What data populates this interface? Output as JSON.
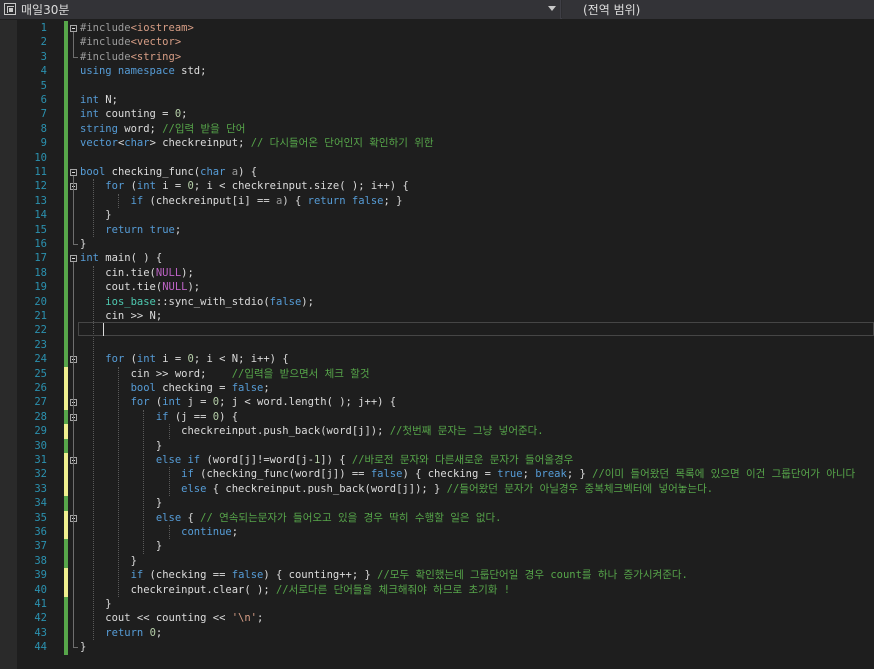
{
  "navigation_bar": {
    "file_label": "매일30분",
    "scope_label": "(전역 범위)"
  },
  "editor": {
    "caret_line": 22,
    "lines": [
      {
        "n": "1",
        "segs": [
          [
            "pp",
            "#include"
          ],
          [
            "st",
            "<iostream>"
          ]
        ]
      },
      {
        "n": "2",
        "segs": [
          [
            "pp",
            "#include"
          ],
          [
            "st",
            "<vector>"
          ]
        ]
      },
      {
        "n": "3",
        "segs": [
          [
            "pp",
            "#include"
          ],
          [
            "st",
            "<string>"
          ]
        ]
      },
      {
        "n": "4",
        "segs": [
          [
            "kw",
            "using"
          ],
          [
            "",
            ""
          ],
          [
            "",
            ""
          ],
          [
            "kw",
            " namespace"
          ],
          [
            "",
            " std;"
          ]
        ]
      },
      {
        "n": "5",
        "segs": []
      },
      {
        "n": "6",
        "segs": [
          [
            "kw",
            "int"
          ],
          [
            "",
            " N;"
          ]
        ]
      },
      {
        "n": "7",
        "segs": [
          [
            "kw",
            "int"
          ],
          [
            "",
            " counting = "
          ],
          [
            "nu",
            "0"
          ],
          [
            "",
            ";"
          ]
        ]
      },
      {
        "n": "8",
        "segs": [
          [
            "kw",
            "string"
          ],
          [
            "",
            " word; "
          ],
          [
            "cm",
            "//입력 받을 단어"
          ]
        ]
      },
      {
        "n": "9",
        "segs": [
          [
            "kw",
            "vector"
          ],
          [
            "",
            "<"
          ],
          [
            "kw",
            "char"
          ],
          [
            "",
            "> checkreinput; "
          ],
          [
            "cm",
            "// 다시들어온 단어인지 확인하기 위한"
          ]
        ]
      },
      {
        "n": "10",
        "segs": []
      },
      {
        "n": "11",
        "segs": [
          [
            "kw",
            "bool"
          ],
          [
            "",
            " checking_func("
          ],
          [
            "kw",
            "char"
          ],
          [
            "",
            " "
          ],
          [
            "pa",
            "a"
          ],
          [
            "",
            ") {"
          ]
        ]
      },
      {
        "n": "12",
        "segs": [
          [
            "",
            "    "
          ],
          [
            "kw",
            "for"
          ],
          [
            "",
            " ("
          ],
          [
            "kw",
            "int"
          ],
          [
            "",
            " i = "
          ],
          [
            "nu",
            "0"
          ],
          [
            "",
            "; i < checkreinput.size( ); i++) {"
          ]
        ]
      },
      {
        "n": "13",
        "segs": [
          [
            "",
            "        "
          ],
          [
            "kw",
            "if"
          ],
          [
            "",
            " (checkreinput[i] == "
          ],
          [
            "pa",
            "a"
          ],
          [
            "",
            ") { "
          ],
          [
            "kw",
            "return"
          ],
          [
            "",
            " "
          ],
          [
            "kw",
            "false"
          ],
          [
            "",
            "; }"
          ]
        ]
      },
      {
        "n": "14",
        "segs": [
          [
            "",
            "    }"
          ]
        ]
      },
      {
        "n": "15",
        "segs": [
          [
            "",
            "    "
          ],
          [
            "kw",
            "return"
          ],
          [
            "",
            " "
          ],
          [
            "kw",
            "true"
          ],
          [
            "",
            ";"
          ]
        ]
      },
      {
        "n": "16",
        "segs": [
          [
            "",
            "}"
          ]
        ]
      },
      {
        "n": "17",
        "segs": [
          [
            "kw",
            "int"
          ],
          [
            "",
            " main( ) {"
          ]
        ]
      },
      {
        "n": "18",
        "segs": [
          [
            "",
            "    cin.tie("
          ],
          [
            "ma",
            "NULL"
          ],
          [
            "",
            ");"
          ]
        ]
      },
      {
        "n": "19",
        "segs": [
          [
            "",
            "    cout.tie("
          ],
          [
            "ma",
            "NULL"
          ],
          [
            "",
            ");"
          ]
        ]
      },
      {
        "n": "20",
        "segs": [
          [
            "",
            "    "
          ],
          [
            "ty",
            "ios_base"
          ],
          [
            "",
            "::sync_with_stdio("
          ],
          [
            "kw",
            "false"
          ],
          [
            "",
            ");"
          ]
        ]
      },
      {
        "n": "21",
        "segs": [
          [
            "",
            "    cin >> N;"
          ]
        ]
      },
      {
        "n": "22",
        "segs": []
      },
      {
        "n": "23",
        "segs": []
      },
      {
        "n": "24",
        "segs": [
          [
            "",
            "    "
          ],
          [
            "kw",
            "for"
          ],
          [
            "",
            " ("
          ],
          [
            "kw",
            "int"
          ],
          [
            "",
            " i = "
          ],
          [
            "nu",
            "0"
          ],
          [
            "",
            "; i < N; i++) {"
          ]
        ]
      },
      {
        "n": "25",
        "segs": [
          [
            "",
            "        cin >> word;    "
          ],
          [
            "cm",
            "//입력을 받으면서 체크 할것"
          ]
        ]
      },
      {
        "n": "26",
        "segs": [
          [
            "",
            "        "
          ],
          [
            "kw",
            "bool"
          ],
          [
            "",
            " checking = "
          ],
          [
            "kw",
            "false"
          ],
          [
            "",
            ";"
          ]
        ]
      },
      {
        "n": "27",
        "segs": [
          [
            "",
            "        "
          ],
          [
            "kw",
            "for"
          ],
          [
            "",
            " ("
          ],
          [
            "kw",
            "int"
          ],
          [
            "",
            " j = "
          ],
          [
            "nu",
            "0"
          ],
          [
            "",
            "; j < word.length( ); j++) {"
          ]
        ]
      },
      {
        "n": "28",
        "segs": [
          [
            "",
            "            "
          ],
          [
            "kw",
            "if"
          ],
          [
            "",
            " (j == "
          ],
          [
            "nu",
            "0"
          ],
          [
            "",
            ") {"
          ]
        ]
      },
      {
        "n": "29",
        "segs": [
          [
            "",
            "                checkreinput.push_back(word[j]); "
          ],
          [
            "cm",
            "//첫번째 문자는 그냥 넣어준다."
          ]
        ]
      },
      {
        "n": "30",
        "segs": [
          [
            "",
            "            }"
          ]
        ]
      },
      {
        "n": "31",
        "segs": [
          [
            "",
            "            "
          ],
          [
            "kw",
            "else"
          ],
          [
            "",
            " "
          ],
          [
            "kw",
            "if"
          ],
          [
            "",
            " (word[j]!=word[j-"
          ],
          [
            "nu",
            "1"
          ],
          [
            "",
            "]) { "
          ],
          [
            "cm",
            "//바로전 문자와 다른새로운 문자가 들어올경우"
          ]
        ]
      },
      {
        "n": "32",
        "segs": [
          [
            "",
            "                "
          ],
          [
            "kw",
            "if"
          ],
          [
            "",
            " (checking_func(word[j]) == "
          ],
          [
            "kw",
            "false"
          ],
          [
            "",
            ") { checking = "
          ],
          [
            "kw",
            "true"
          ],
          [
            "",
            "; "
          ],
          [
            "kw",
            "break"
          ],
          [
            "",
            "; } "
          ],
          [
            "cm",
            "//이미 들어왔던 목록에 있으면 이건 그룹단어가 아니다"
          ]
        ]
      },
      {
        "n": "33",
        "segs": [
          [
            "",
            "                "
          ],
          [
            "kw",
            "else"
          ],
          [
            "",
            " { checkreinput.push_back(word[j]); } "
          ],
          [
            "cm",
            "//들어왔던 문자가 아닐경우 중복체크벡터에 넣어놓는다."
          ]
        ]
      },
      {
        "n": "34",
        "segs": [
          [
            "",
            "            }"
          ]
        ]
      },
      {
        "n": "35",
        "segs": [
          [
            "",
            "            "
          ],
          [
            "kw",
            "else"
          ],
          [
            "",
            " { "
          ],
          [
            "cm",
            "// 연속되는문자가 들어오고 있을 경우 딱히 수행할 일은 없다."
          ]
        ]
      },
      {
        "n": "36",
        "segs": [
          [
            "",
            "                "
          ],
          [
            "kw",
            "continue"
          ],
          [
            "",
            ";"
          ]
        ]
      },
      {
        "n": "37",
        "segs": [
          [
            "",
            "            }"
          ]
        ]
      },
      {
        "n": "38",
        "segs": [
          [
            "",
            "        }"
          ]
        ]
      },
      {
        "n": "39",
        "segs": [
          [
            "",
            "        "
          ],
          [
            "kw",
            "if"
          ],
          [
            "",
            " (checking == "
          ],
          [
            "kw",
            "false"
          ],
          [
            "",
            ") { counting++; } "
          ],
          [
            "cm",
            "//모두 확인했는데 그룹단어일 경우 count를 하나 증가시켜준다."
          ]
        ]
      },
      {
        "n": "40",
        "segs": [
          [
            "",
            "        checkreinput.clear( ); "
          ],
          [
            "cm",
            "//서로다른 단어들을 체크해줘야 하므로 초기화 !"
          ]
        ]
      },
      {
        "n": "41",
        "segs": [
          [
            "",
            "    }"
          ]
        ]
      },
      {
        "n": "42",
        "segs": [
          [
            "",
            "    cout << counting << "
          ],
          [
            "st",
            "'\\n'"
          ],
          [
            "",
            ";"
          ]
        ]
      },
      {
        "n": "43",
        "segs": [
          [
            "",
            "    "
          ],
          [
            "kw",
            "return"
          ],
          [
            "",
            " "
          ],
          [
            "nu",
            "0"
          ],
          [
            "",
            ";"
          ]
        ]
      },
      {
        "n": "44",
        "segs": [
          [
            "",
            "}"
          ]
        ]
      }
    ]
  }
}
